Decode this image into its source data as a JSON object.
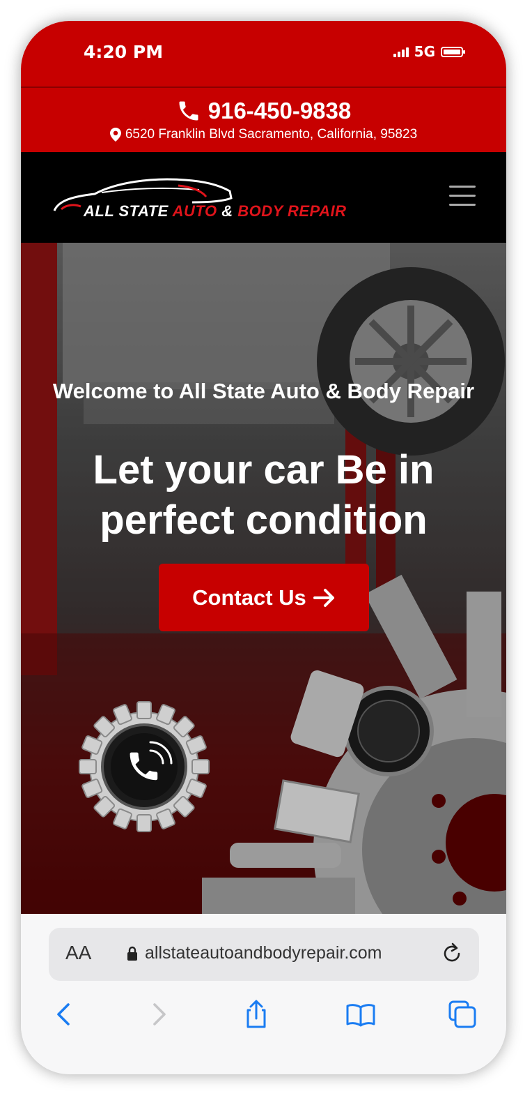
{
  "status_bar": {
    "time": "4:20 PM",
    "network": "5G"
  },
  "contact": {
    "phone": "916-450-9838",
    "address": "6520 Franklin Blvd Sacramento, California, 95823"
  },
  "nav": {
    "logo_words": [
      "ALL STATE",
      "AUTO",
      "&",
      "BODY REPAIR"
    ],
    "menu_icon": "hamburger-menu-icon"
  },
  "hero": {
    "welcome": "Welcome to All State Auto & Body Repair",
    "headline": "Let your car Be in perfect condition",
    "cta_label": "Contact Us",
    "cta_icon": "arrow-right-icon",
    "call_icon": "phone-call-icon"
  },
  "browser": {
    "aa_label": "AA",
    "url": "allstateautoandbodyrepair.com",
    "icons": [
      "lock-icon",
      "reload-icon",
      "back-icon",
      "forward-icon",
      "share-icon",
      "bookmarks-icon",
      "tabs-icon"
    ]
  },
  "colors": {
    "brand_red": "#c70000",
    "nav_black": "#000000",
    "safari_blue": "#1a7cf2"
  }
}
